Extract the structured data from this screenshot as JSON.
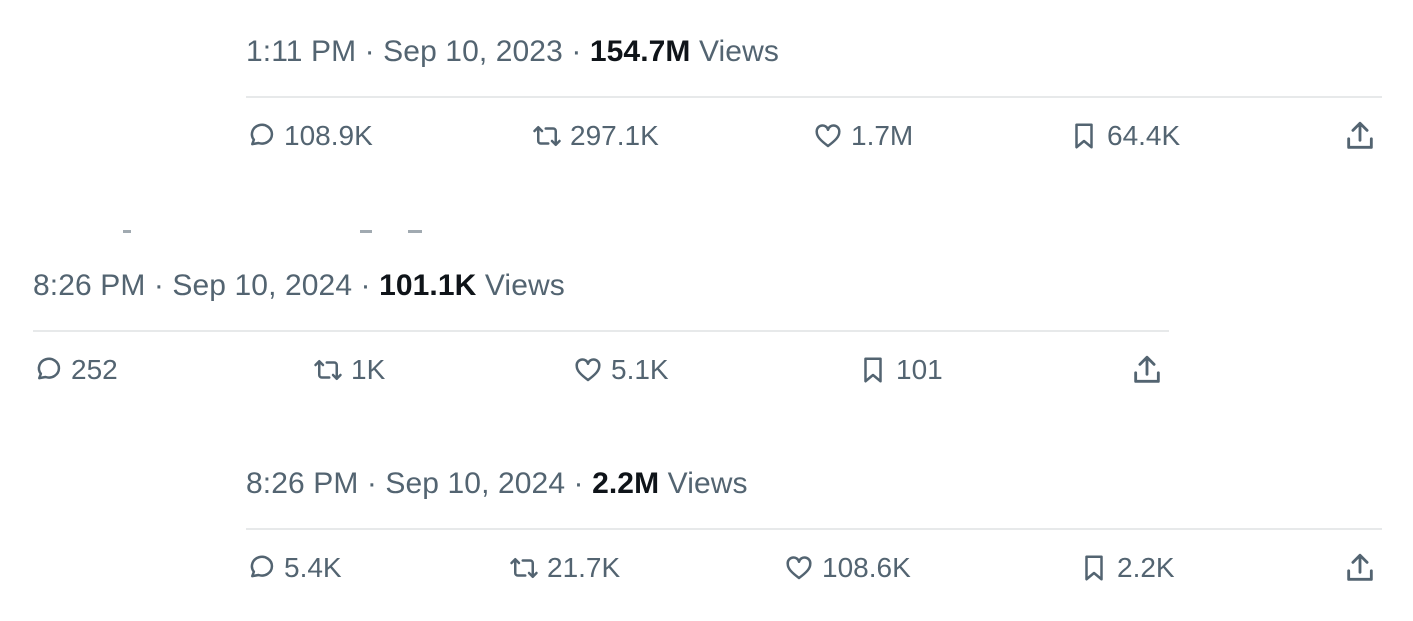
{
  "tweets": [
    {
      "time": "1:11 PM",
      "date": "Sep 10, 2023",
      "views_count": "154.7M",
      "views_label": "Views",
      "replies": "108.9K",
      "retweets": "297.1K",
      "likes": "1.7M",
      "bookmarks": "64.4K"
    },
    {
      "time": "8:26 PM",
      "date": "Sep 10, 2024",
      "views_count": "101.1K",
      "views_label": "Views",
      "replies": "252",
      "retweets": "1K",
      "likes": "5.1K",
      "bookmarks": "101"
    },
    {
      "time": "8:26 PM",
      "date": "Sep 10, 2024",
      "views_count": "2.2M",
      "views_label": "Views",
      "replies": "5.4K",
      "retweets": "21.7K",
      "likes": "108.6K",
      "bookmarks": "2.2K"
    }
  ],
  "separator": "·",
  "icons": {
    "reply": "reply-icon",
    "retweet": "retweet-icon",
    "like": "heart-icon",
    "bookmark": "bookmark-icon",
    "share": "share-icon"
  },
  "colors": {
    "text_secondary": "#536471",
    "text_primary": "#0f1419",
    "divider": "#e7e9ea"
  }
}
